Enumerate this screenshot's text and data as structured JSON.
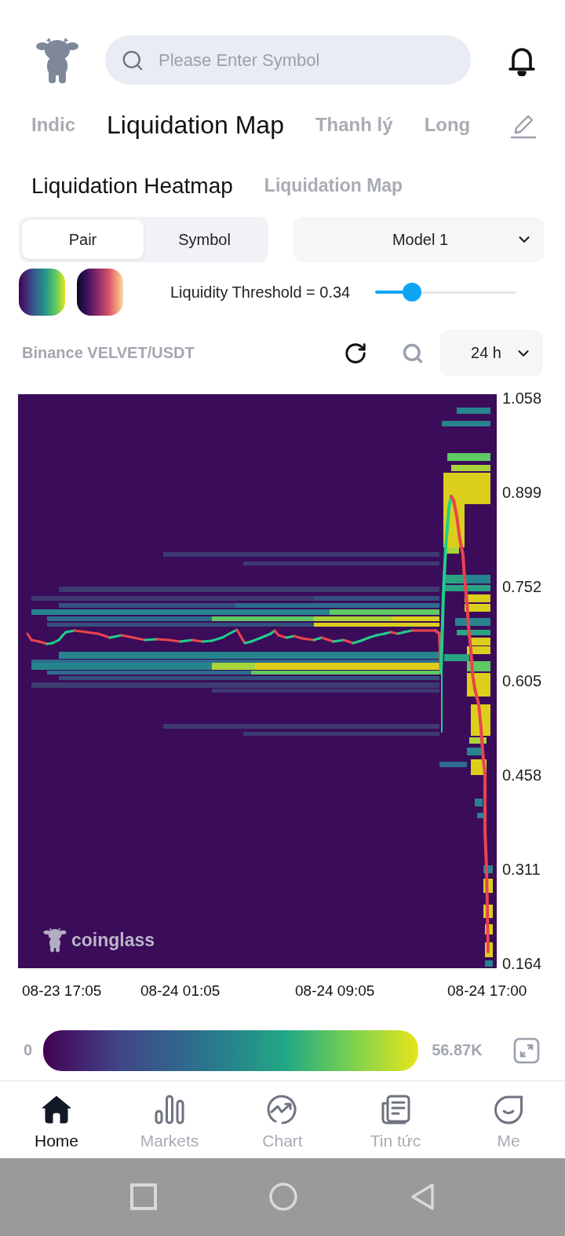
{
  "header": {
    "search": {
      "placeholder": "Please Enter Symbol"
    }
  },
  "tabs": [
    {
      "label": "Indic",
      "selected": false
    },
    {
      "label": "Liquidation Map",
      "selected": true
    },
    {
      "label": "Thanh lý",
      "selected": false
    },
    {
      "label": "Long",
      "selected": false
    }
  ],
  "sub_tabs": [
    {
      "label": "Liquidation Heatmap",
      "selected": true
    },
    {
      "label": "Liquidation Map",
      "selected": false
    }
  ],
  "pair_toggle": [
    {
      "label": "Pair",
      "selected": true
    },
    {
      "label": "Symbol",
      "selected": false
    }
  ],
  "model_select": {
    "value": "Model 1"
  },
  "threshold": {
    "label": "Liquidity Threshold = 0.34",
    "level": 0.26
  },
  "market": {
    "title": "Binance VELVET/USDT"
  },
  "range_select": {
    "value": "24 h"
  },
  "heatmap": {
    "watermark": "coinglass",
    "y_labels": [
      "1.058",
      "0.899",
      "0.752",
      "0.605",
      "0.458",
      "0.311",
      "0.164"
    ],
    "x_labels": [
      "08-23 17:05",
      "08-24 01:05",
      "08-24 09:05",
      "08-24 17:00"
    ]
  },
  "color_scale": {
    "min_label": "0",
    "max_label": "56.87K"
  },
  "bottom_nav": [
    {
      "label": "Home",
      "selected": true
    },
    {
      "label": "Markets",
      "selected": false
    },
    {
      "label": "Chart",
      "selected": false
    },
    {
      "label": "Tin tức",
      "selected": false
    },
    {
      "label": "Me",
      "selected": false
    }
  ]
}
